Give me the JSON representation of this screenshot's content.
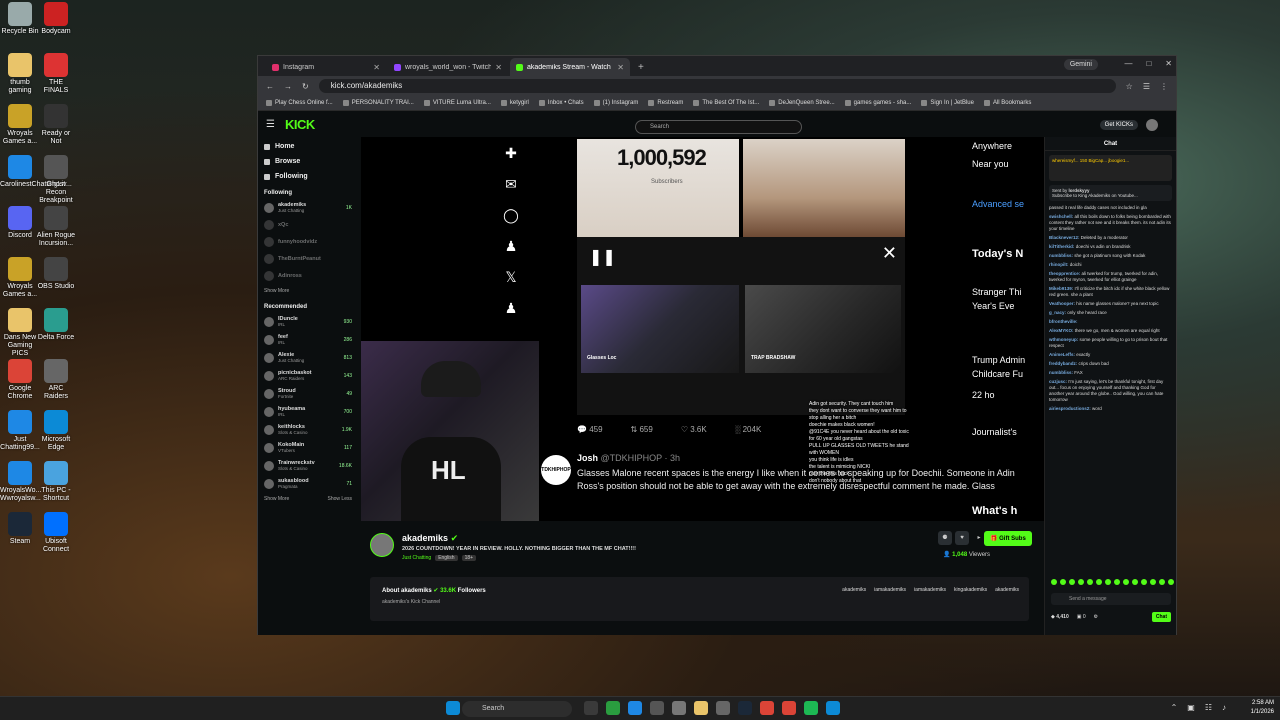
{
  "desktop": {
    "icons": [
      {
        "label": "Recycle Bin",
        "color": "#9aa"
      },
      {
        "label": "Bodycam",
        "color": "#c22"
      },
      {
        "label": "thumb gaming",
        "color": "#e9c46a"
      },
      {
        "label": "THE FINALS",
        "color": "#d33"
      },
      {
        "label": "Wroyals Games a...",
        "color": "#c9a227"
      },
      {
        "label": "Ready or Not",
        "color": "#333"
      },
      {
        "label": "CarolinestChattingLiv...",
        "color": "#1e88e5"
      },
      {
        "label": "Ghost Recon Breakpoint",
        "color": "#555"
      },
      {
        "label": "Discord",
        "color": "#5865f2"
      },
      {
        "label": "Alien Rogue Incursion...",
        "color": "#444"
      },
      {
        "label": "Wroyals Games a...",
        "color": "#c9a227"
      },
      {
        "label": "OBS Studio",
        "color": "#444"
      },
      {
        "label": "Dans New Gaming PICS",
        "color": "#e9c46a"
      },
      {
        "label": "Delta Force",
        "color": "#2a9d8f"
      },
      {
        "label": "Google Chrome",
        "color": "#db4437"
      },
      {
        "label": "ARC Raiders",
        "color": "#666"
      },
      {
        "label": "Just Chatting99...",
        "color": "#1e88e5"
      },
      {
        "label": "Microsoft Edge",
        "color": "#0c8ad6"
      },
      {
        "label": "WroyalsWo... Wwroyalsw...",
        "color": "#1e88e5"
      },
      {
        "label": "This PC - Shortcut",
        "color": "#4aa3df"
      },
      {
        "label": "Steam",
        "color": "#1b2838"
      },
      {
        "label": "Ubisoft Connect",
        "color": "#0070ff"
      }
    ]
  },
  "browser": {
    "tabs": [
      {
        "label": "Instagram",
        "color": "#e1306c",
        "active": false
      },
      {
        "label": "wroyals_world_won - Twitch",
        "color": "#9146ff",
        "active": false
      },
      {
        "label": "akademiks Stream - Watch",
        "color": "#53fc18",
        "active": true
      }
    ],
    "new_tab": "+",
    "gemini": "Gemini",
    "url": "kick.com/akademiks",
    "bookmarks": [
      "Play Chess Online f...",
      "PERSONALITY TRAI...",
      "VITURE Luma Ultra...",
      "ketygirl",
      "Inbox • Chats",
      "(1) Instagram",
      "Restream",
      "The Best Of The Ist...",
      "DeJenQueen Stree...",
      "games games - sha...",
      "Sign In | JetBlue",
      "All Bookmarks"
    ]
  },
  "kick": {
    "logo": "KICK",
    "search_placeholder": "Search",
    "get_kicks": "Get KICKs",
    "nav": [
      "Home",
      "Browse",
      "Following"
    ],
    "following_title": "Following",
    "following": [
      {
        "name": "akademiks",
        "sub": "Just Chatting",
        "viewers": "1K",
        "dim": false
      },
      {
        "name": "xQc",
        "sub": "",
        "viewers": "",
        "dim": true
      },
      {
        "name": "funnyhoodvidz",
        "sub": "",
        "viewers": "",
        "dim": true
      },
      {
        "name": "TheBurntPeanut",
        "sub": "",
        "viewers": "",
        "dim": true
      },
      {
        "name": "Adinross",
        "sub": "",
        "viewers": "",
        "dim": true
      }
    ],
    "show_more": "Show More",
    "recommended_title": "Recommended",
    "recommended": [
      {
        "name": "IDuncle",
        "sub": "IRL",
        "viewers": "930"
      },
      {
        "name": "feef",
        "sub": "IRL",
        "viewers": "286"
      },
      {
        "name": "Alexie",
        "sub": "Just Chatting",
        "viewers": "813"
      },
      {
        "name": "picnicbaskot",
        "sub": "ARC Raiders",
        "viewers": "143"
      },
      {
        "name": "Stroud",
        "sub": "Fortnite",
        "viewers": "49"
      },
      {
        "name": "hyubeama",
        "sub": "IRL",
        "viewers": "700"
      },
      {
        "name": "keithlocks",
        "sub": "Slots & Casino",
        "viewers": "1.9K"
      },
      {
        "name": "KokoMain",
        "sub": "VTubers",
        "viewers": "117"
      },
      {
        "name": "Trainwreckstv",
        "sub": "Slots & Casino",
        "viewers": "18.6K"
      },
      {
        "name": "sukasblood",
        "sub": "Pragmata",
        "viewers": "71"
      }
    ],
    "show_more_2": "Show More",
    "show_less": "Show Less"
  },
  "video": {
    "side_icons": [
      "add-user-icon",
      "mail-icon",
      "grok-icon",
      "communities-icon",
      "x-logo-icon",
      "profile-icon"
    ],
    "sub_count": "1,000,592",
    "sub_label": "Subscribers",
    "thumb1_label": "Glasses Loc",
    "thumb2_label": "TRAP BRADSHAW",
    "stats": {
      "replies": "459",
      "reposts": "659",
      "likes": "3.6K",
      "views": "204K"
    },
    "tweet": {
      "avatar": "TDKHIPHOP",
      "author": "Josh",
      "handle": "@TDKHIPHOP · 3h",
      "body": "Glasses Malone recent spaces is the energy I like when it comes to speaking up for Doechii. Someone in Adin Ross's position should not be able to get away with the extremely disrespectful comment he made. Glass"
    },
    "right_col": {
      "line1": "Anywhere",
      "line2": "Near you",
      "adv": "Advanced se",
      "todays": "Today's N",
      "stranger": "Stranger Thi",
      "years_eve": "Year's Eve",
      "trump": "Trump Admin",
      "childcare": "Childcare Fu",
      "journalist": "Journalist's",
      "whats": "What's h",
      "count": "22 ho"
    },
    "chat_overlay": [
      "Adin got security. They cant touch him",
      "they dont want to converse they want him to",
      "stop alling her a bitch",
      "doechie makes black women!",
      "@91C4E you never heard about the old toxic",
      "for 60 year old gangstas",
      "PULL UP GLASSES OLD TWEETS he stand",
      "with WOMEN",
      "you think life is idles",
      "the talent is mimicing NICKI",
      "play the diss track",
      "don't nobody about that"
    ],
    "facecam_shirt": "HL"
  },
  "channel": {
    "name": "akademiks",
    "title": "2026 COUNTDOWN! YEAR IN REVIEW. HOLLY. NOTHING BIGGER THAN THE MF CHAT!!!!",
    "category": "Just Chatting",
    "lang": "English",
    "age": "18+",
    "gift": "Gift Subs",
    "viewers_num": "1,048",
    "viewers_word": "Viewers",
    "about": "About akademiks",
    "followers_num": "33.6K",
    "followers_word": "Followers",
    "description": "akademiks's Kick Channel",
    "socials": [
      "akademiks",
      "iamakademiks",
      "iamakademiks",
      "kingakademiks",
      "akademiks"
    ]
  },
  "chat": {
    "title": "Chat",
    "leaderboard": [
      "whereismyf... 150",
      "BigCap...",
      "jboogie1..."
    ],
    "pinned_by": "Sent by",
    "pinned_user": "lordskyyy",
    "pinned_text": "Subscribe to King Akademiks on Youtube...",
    "messages": [
      {
        "u": "",
        "t": "passed it real life daddy cases not included in gla"
      },
      {
        "u": "swishchell:",
        "t": "all this boils down to folks being bombarded with content they rather not see and it breaks them. its not adin its your timeline"
      },
      {
        "u": "Blacknever12:",
        "t": "Deleted by a moderator"
      },
      {
        "u": "kilTitherkid:",
        "t": "doechi vs adin on brandrisk"
      },
      {
        "u": "numbbliss:",
        "t": "she got a platinum song with Kodak"
      },
      {
        "u": "rhinopilt:",
        "t": "doichi"
      },
      {
        "u": "theopprentice:",
        "t": "ali twerked for trump, twerked for adin, twerked for myron, twerked for elliot grainge"
      },
      {
        "u": "Mikeb9139:",
        "t": "I'll criticize the bitch idc if she white black yellow red green. she a plant"
      },
      {
        "u": "Veathooper:",
        "t": "his name glasses malone? yea next topic"
      },
      {
        "u": "g_nacy:",
        "t": "only she heard race"
      },
      {
        "u": "bfrontheville:",
        "t": ""
      },
      {
        "u": "AlexMYKO:",
        "t": "there we go, men & women are equal right"
      },
      {
        "u": "wthmoneyup:",
        "t": "some people willing to go to prison bout that respect"
      },
      {
        "u": "AnimeLeffs:",
        "t": "exactly"
      },
      {
        "u": "freddybandz:",
        "t": "crips down bad"
      },
      {
        "u": "numbbliss:",
        "t": "FAX"
      },
      {
        "u": "cuzjusc:",
        "t": "I'm just saying, let's be thankful tonight, first day out... focus on enjoying yourself and thanking God for another year around the globe.. God willing, you can hate tomorrow"
      },
      {
        "u": "airiesproductions2:",
        "t": "word"
      }
    ],
    "send_placeholder": "Send a message",
    "kicks": "4,410",
    "zero": "0",
    "chat_btn": "Chat"
  },
  "taskbar": {
    "search": "Search",
    "time": "2:58 AM",
    "date": "1/1/2026"
  }
}
